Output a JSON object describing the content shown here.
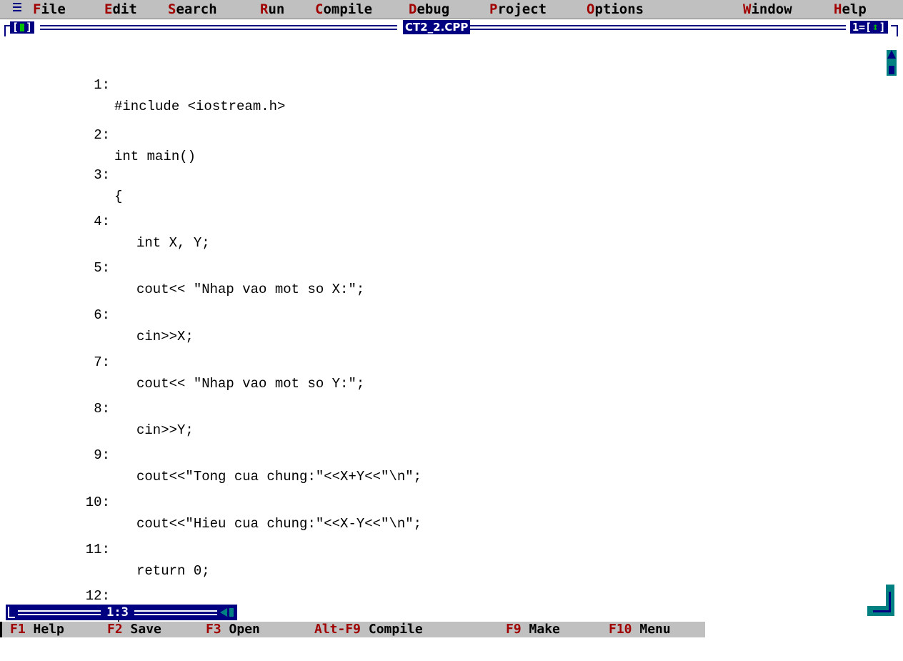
{
  "menubar": {
    "system_menu_glyph": "≡",
    "items": [
      {
        "hot": "F",
        "rest": "ile"
      },
      {
        "hot": "E",
        "rest": "dit"
      },
      {
        "hot": "S",
        "rest": "earch"
      },
      {
        "hot": "R",
        "rest": "un"
      },
      {
        "hot": "C",
        "rest": "ompile"
      },
      {
        "hot": "D",
        "rest": "ebug"
      },
      {
        "hot": "P",
        "rest": "roject"
      },
      {
        "hot": "O",
        "rest": "ptions"
      },
      {
        "hot": "W",
        "rest": "indow"
      },
      {
        "hot": "H",
        "rest": "elp"
      }
    ]
  },
  "window": {
    "title": "CT2_2.CPP",
    "number": "1",
    "close_left_bracket": "[",
    "close_right_bracket": "]",
    "zoom_prefix": "=[",
    "zoom_glyph": "↕",
    "zoom_suffix": "]"
  },
  "editor": {
    "lines": [
      {
        "num": "1:",
        "code": "#include <iostream.h>"
      },
      {
        "num": "2:",
        "code": "int main()"
      },
      {
        "num": "3:",
        "code": "{"
      },
      {
        "num": "4:",
        "code": "int X, Y;"
      },
      {
        "num": "5:",
        "code": "cout<< \"Nhap vao mot so X:\";"
      },
      {
        "num": "6:",
        "code": "cin>>X;"
      },
      {
        "num": "7:",
        "code": "cout<< \"Nhap vao mot so Y:\";"
      },
      {
        "num": "8:",
        "code": "cin>>Y;"
      },
      {
        "num": "9:",
        "code": "cout<<\"Tong cua chung:\"<<X+Y<<\"\\n\";"
      },
      {
        "num": "10:",
        "code": "cout<<\"Hieu cua chung:\"<<X-Y<<\"\\n\";"
      },
      {
        "num": "11:",
        "code": "return 0;"
      },
      {
        "num": "12:",
        "code": "}"
      }
    ]
  },
  "status": {
    "cursor_position": "1:3"
  },
  "function_keys": [
    {
      "key": "F1",
      "label": "Help"
    },
    {
      "key": "F2",
      "label": "Save"
    },
    {
      "key": "F3",
      "label": "Open"
    },
    {
      "key": "Alt-F9",
      "label": "Compile"
    },
    {
      "key": "F9",
      "label": "Make"
    },
    {
      "key": "F10",
      "label": "Menu"
    }
  ],
  "colors": {
    "menu_bg": "#c0c0c0",
    "hotkey": "#a00000",
    "frame": "#000080",
    "accent_green": "#00c000",
    "scroll_teal": "#008080",
    "editor_bg": "#ffffff"
  }
}
